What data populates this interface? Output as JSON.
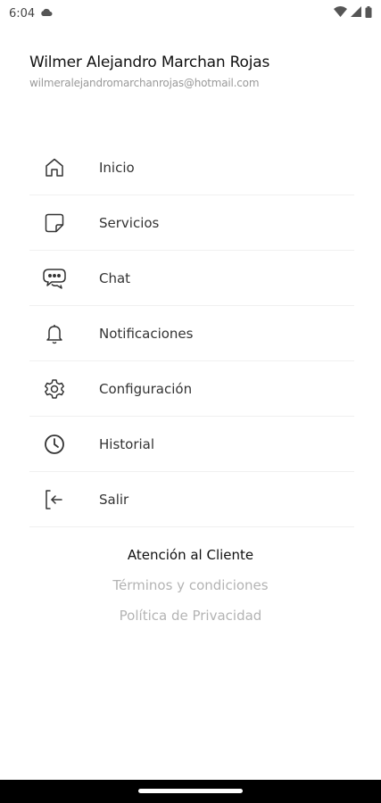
{
  "status_bar": {
    "time": "6:04"
  },
  "profile": {
    "name": "Wilmer Alejandro Marchan Rojas",
    "email": "wilmeralejandromarchanrojas@hotmail.com"
  },
  "menu": {
    "items": [
      {
        "label": "Inicio",
        "icon": "home-icon"
      },
      {
        "label": "Servicios",
        "icon": "sticky-note-icon"
      },
      {
        "label": "Chat",
        "icon": "chat-icon"
      },
      {
        "label": "Notificaciones",
        "icon": "bell-icon"
      },
      {
        "label": "Configuración",
        "icon": "gear-icon"
      },
      {
        "label": "Historial",
        "icon": "clock-icon"
      },
      {
        "label": "Salir",
        "icon": "logout-icon"
      }
    ]
  },
  "links": {
    "customer_service": "Atención al Cliente",
    "terms": "Términos y condiciones",
    "privacy": "Política de Privacidad"
  },
  "colors": {
    "background": "#ffffff",
    "text_primary": "#111111",
    "text_muted": "#b4b4b4",
    "divider": "#f0f0f0"
  }
}
